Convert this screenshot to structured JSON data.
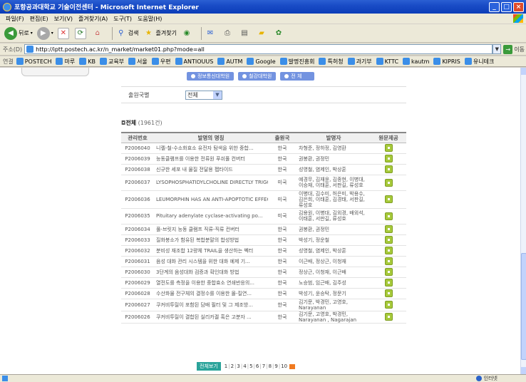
{
  "window": {
    "title": "포항공과대학교 기술이전센터 - Microsoft Internet Explorer"
  },
  "menu": [
    "파일(F)",
    "편집(E)",
    "보기(V)",
    "즐겨찾기(A)",
    "도구(T)",
    "도움말(H)"
  ],
  "toolbar": {
    "back_label": "뒤로",
    "search_label": "검색",
    "favorites_label": "즐겨찾기"
  },
  "address": {
    "label": "주소(D)",
    "url": "http://iptt.postech.ac.kr/n_market/market01.php?mode=all",
    "go_label": "이동"
  },
  "links": {
    "label": "연결",
    "items": [
      "POSTECH",
      "마루",
      "KB",
      "교육부",
      "서울",
      "우편",
      "ANTIOUUS",
      "AUTM",
      "Google",
      "발명진흥회",
      "특허청",
      "과기부",
      "KTTC",
      "kautm",
      "KIPRIS",
      "유니테크"
    ]
  },
  "categories": [
    "정보통신대학원",
    "철강대학원",
    "전 체"
  ],
  "filter": {
    "label": "출원국별",
    "value": "전체"
  },
  "results": {
    "title": "전체",
    "count": "(1961건)",
    "headers": [
      "관리번호",
      "발명의 명칭",
      "출원국",
      "발명자",
      "원문제공"
    ],
    "rows": [
      {
        "id": "P2006040",
        "name": "니켈-철-수소화효소 유전자 탐색을 위한 중합...",
        "country": "한국",
        "inventors": "차형준, 정하정, 김영환"
      },
      {
        "id": "P2006039",
        "name": "능동클램프를 이용한 전류원 푸쉬풀 컨버터",
        "country": "한국",
        "inventors": "권봉환, 권정민"
      },
      {
        "id": "P2006038",
        "name": "신규한 세포 내 물질 전달용 펩타이드",
        "country": "한국",
        "inventors": "성영철, 염제인, 박상훈"
      },
      {
        "id": "P2006037",
        "name": "LYSOPHOSPHATIDYLCHOLINE DIRECTLY TRIGGERS...",
        "country": "미국",
        "inventors": "예경무, 김재윤, 김종현, 이병대, 이승재, 이태훈, 서판길, 류성호"
      },
      {
        "id": "P2006036",
        "name": "LEUMORPHIN HAS AN ANTI-APOPTOTIC EFFECT B...",
        "country": "미국",
        "inventors": "이병대, 김수미, 허은미, 박용수, 김은희, 이태훈, 김경태, 서판길, 류성호"
      },
      {
        "id": "P2006035",
        "name": "Pituitary adenylate cyclase-activating po...",
        "country": "미국",
        "inventors": "김용원, 이병대, 김외경, 배외석, 이태훈, 서판길, 류성호"
      },
      {
        "id": "P2006034",
        "name": "풀-브릿지 능동 클램프 직류-직류 컨버터",
        "country": "한국",
        "inventors": "권봉환, 권정민"
      },
      {
        "id": "P2006033",
        "name": "질화붕소가 함유된 복합분말의 합성방법",
        "country": "한국",
        "inventors": "박성기, 정운철"
      },
      {
        "id": "P2006032",
        "name": "분비성 재조합 12량체 TRAIL을 생산하는 벡터",
        "country": "한국",
        "inventors": "성영철, 염제인, 박상훈"
      },
      {
        "id": "P2006031",
        "name": "음성 대화 관리 시스템을 위한 대화 예제 기...",
        "country": "한국",
        "inventors": "이근배, 정상근, 이청재"
      },
      {
        "id": "P2006030",
        "name": "3단계의 음성대화 검증과 확인대화 방법",
        "country": "한국",
        "inventors": "정상근, 이청재, 이근배"
      },
      {
        "id": "P2006029",
        "name": "열전도를 측정을 이용한 중합효소 연쇄반응의...",
        "country": "한국",
        "inventors": "노승범, 임근배, 김주성"
      },
      {
        "id": "P2006028",
        "name": "수산화물 전구체의 결정수를 이용한 몰-킬연...",
        "country": "한국",
        "inventors": "박성기, 윤승탁, 정문기"
      },
      {
        "id": "P2006027",
        "name": "쿠커비투릴이 포함된 담배 필터 및 그 제조방...",
        "country": "한국",
        "inventors": "김기문, 박경민, 고영호, Narayanan"
      },
      {
        "id": "P2006026",
        "name": "쿠커비투릴이 결합된 실리카겔 혹은 고분자 ...",
        "country": "한국",
        "inventors": "김기문, 고영호, 박경민, Narayanan , Nagarajan"
      }
    ]
  },
  "pager": {
    "view_all": "전체보기",
    "pages": [
      "1",
      "2",
      "3",
      "4",
      "5",
      "6",
      "7",
      "8",
      "9",
      "10"
    ]
  },
  "status": {
    "zone": "인터넷"
  }
}
